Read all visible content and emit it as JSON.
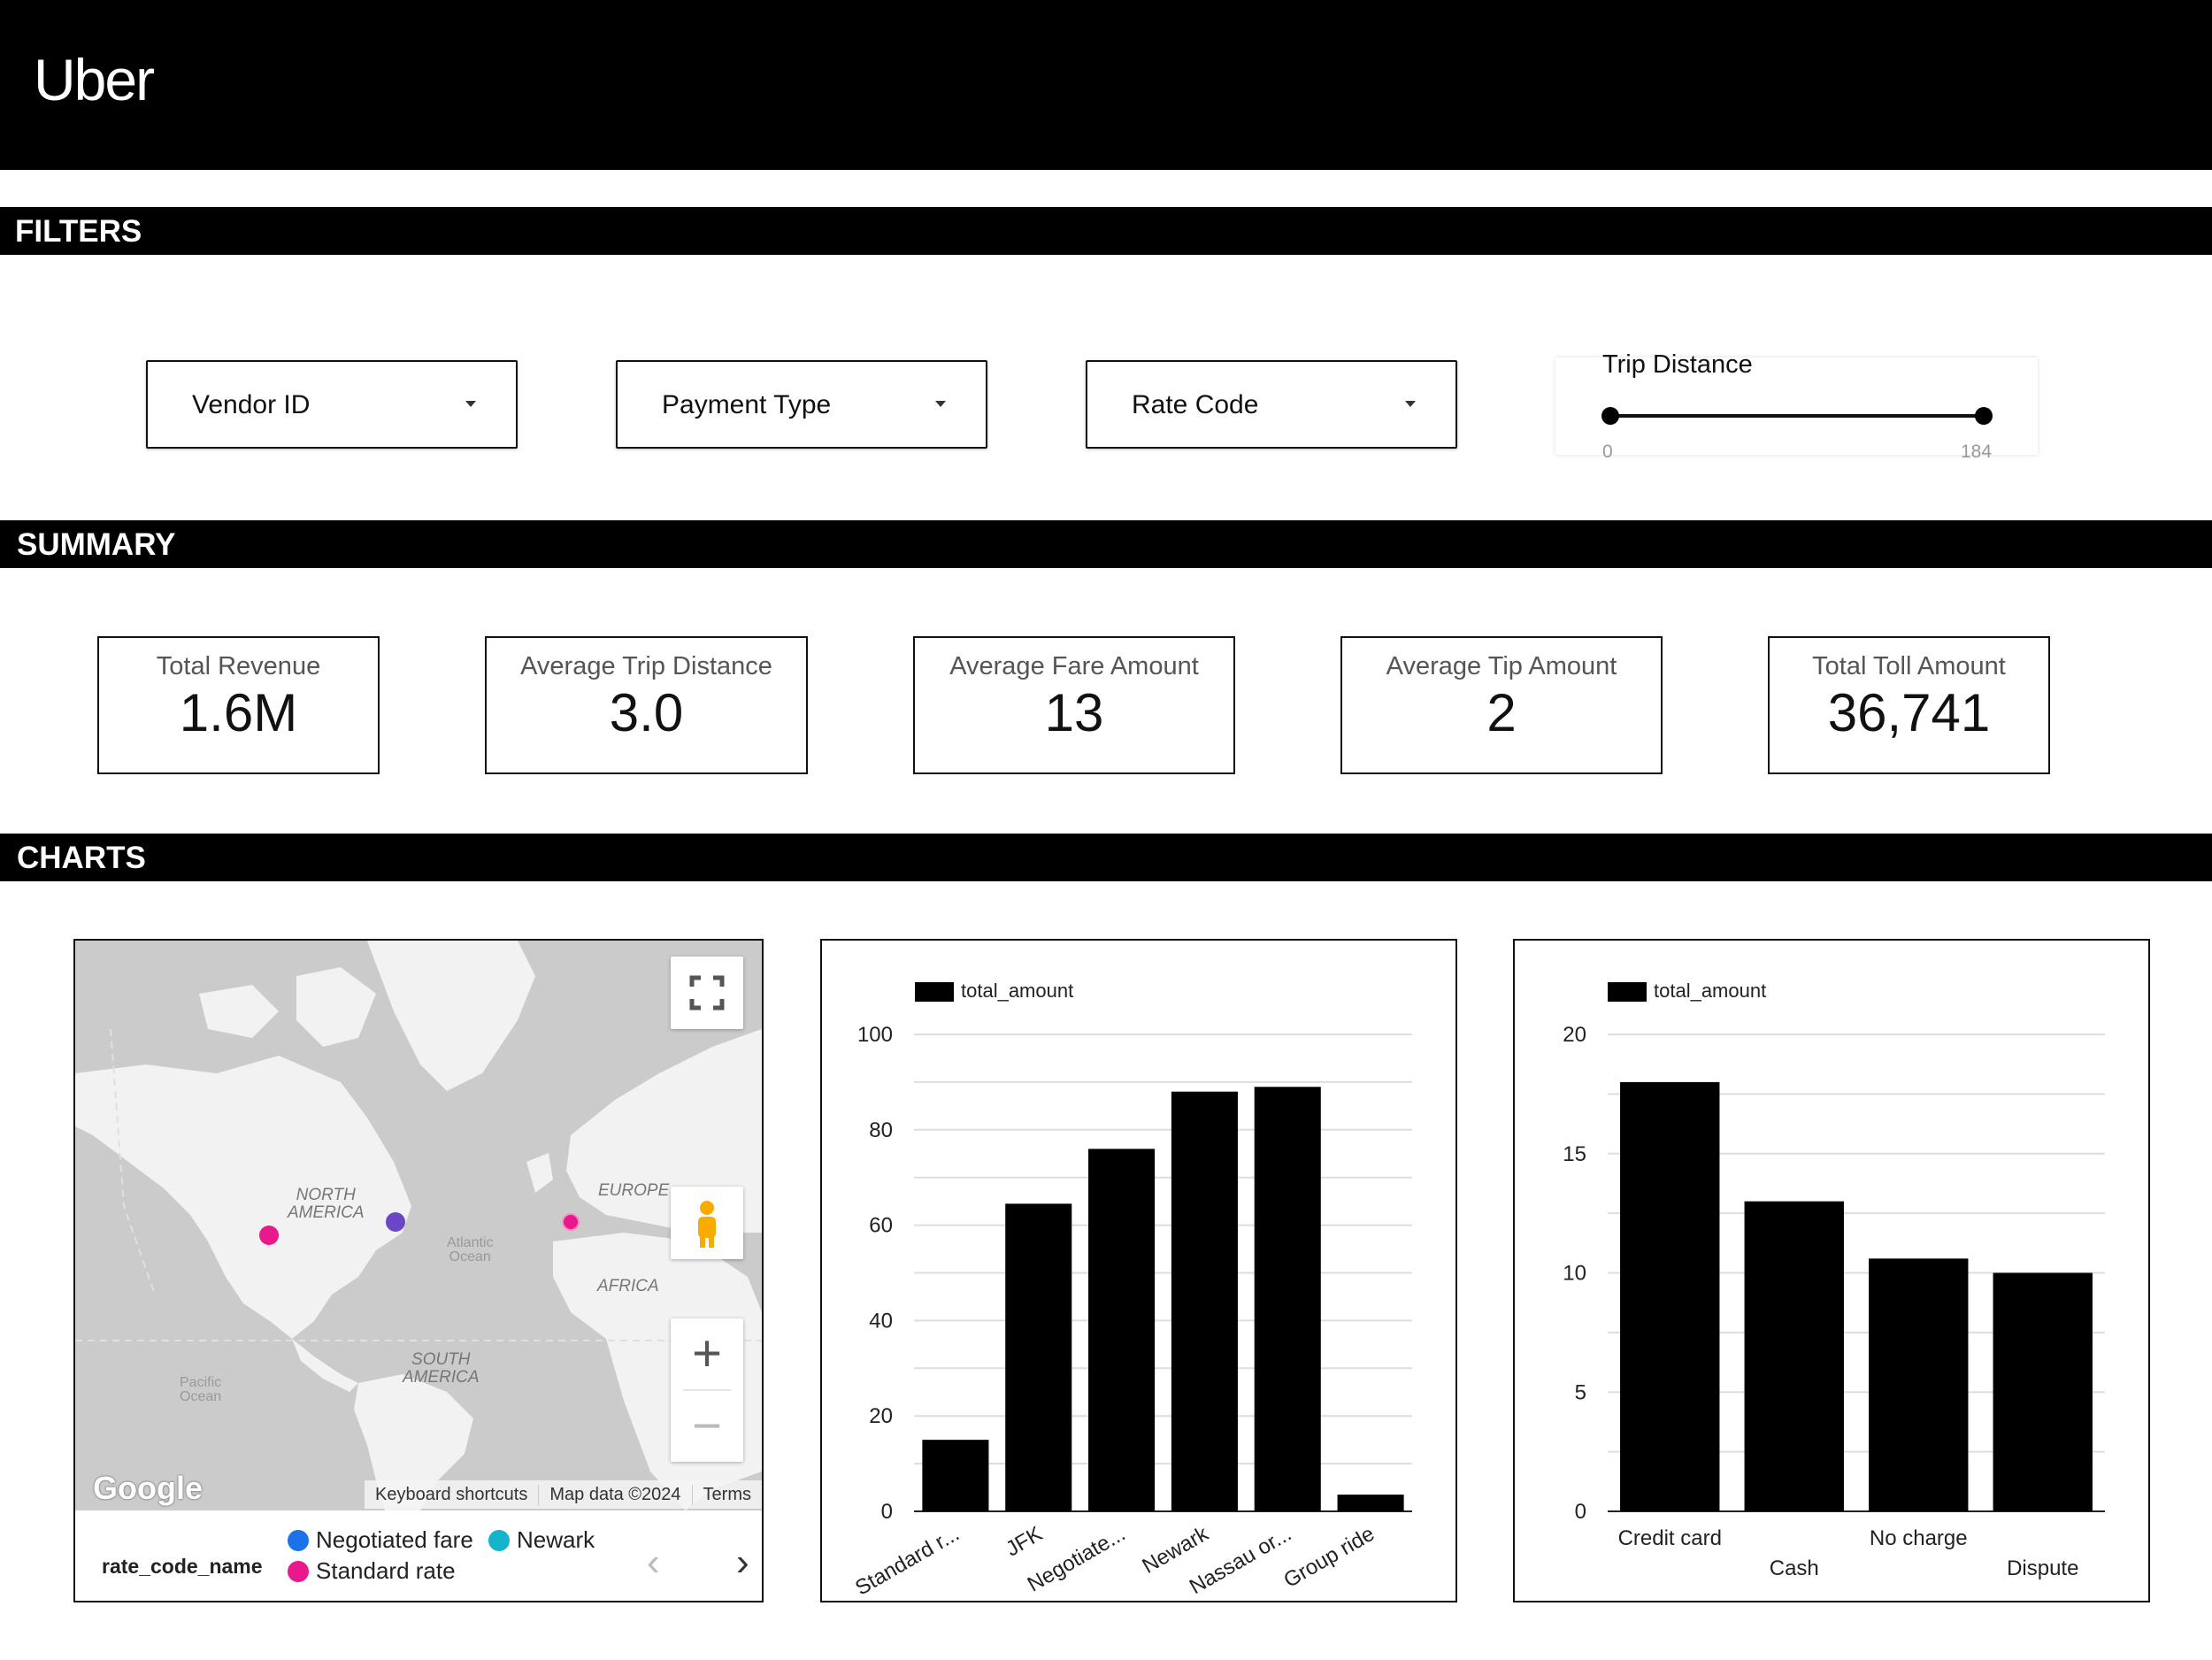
{
  "app": {
    "logo": "Uber"
  },
  "sections": {
    "filters": "FILTERS",
    "summary": "SUMMARY",
    "charts": "CHARTS"
  },
  "filters": {
    "vendor": "Vendor ID",
    "payment": "Payment Type",
    "rate": "Rate Code",
    "trip_distance": {
      "label": "Trip Distance",
      "min": "0",
      "max": "184"
    }
  },
  "summary": {
    "total_revenue": {
      "label": "Total Revenue",
      "value": "1.6M"
    },
    "avg_trip_distance": {
      "label": "Average Trip Distance",
      "value": "3.0"
    },
    "avg_fare": {
      "label": "Average Fare Amount",
      "value": "13"
    },
    "avg_tip": {
      "label": "Average Tip Amount",
      "value": "2"
    },
    "total_toll": {
      "label": "Total Toll Amount",
      "value": "36,741"
    }
  },
  "map": {
    "labels": {
      "north_america_1": "NORTH",
      "north_america_2": "AMERICA",
      "europe": "EUROPE",
      "africa": "AFRICA",
      "south_america_1": "SOUTH",
      "south_america_2": "AMERICA",
      "atlantic_1": "Atlantic",
      "atlantic_2": "Ocean",
      "pacific_1": "Pacific",
      "pacific_2": "Ocean"
    },
    "brand": "Google",
    "footer": {
      "shortcuts": "Keyboard shortcuts",
      "data": "Map data ©2024",
      "terms": "Terms"
    },
    "legend": {
      "title": "rate_code_name",
      "items": [
        {
          "label": "Negotiated fare",
          "color": "#1a73e8"
        },
        {
          "label": "Newark",
          "color": "#12b5cb"
        },
        {
          "label": "Standard rate",
          "color": "#e8198b"
        }
      ]
    },
    "controls": {
      "zoom_in": "+",
      "zoom_out": "−",
      "prev": "‹",
      "next": "›"
    }
  },
  "chart_data": [
    {
      "type": "bar",
      "legend": "total_amount",
      "categories": [
        "Standard r...",
        "JFK",
        "Negotiate...",
        "Newark",
        "Nassau or...",
        "Group ride"
      ],
      "values": [
        15,
        64.5,
        76,
        88,
        89,
        3.5
      ],
      "yticks": [
        "0",
        "20",
        "40",
        "60",
        "80",
        "100"
      ],
      "ylim": [
        0,
        100
      ],
      "grid": true,
      "color": "#000000"
    },
    {
      "type": "bar",
      "legend": "total_amount",
      "categories": [
        "Credit card",
        "Cash",
        "No charge",
        "Dispute"
      ],
      "values": [
        18,
        13,
        10.6,
        10
      ],
      "yticks": [
        "0",
        "5",
        "10",
        "15",
        "20"
      ],
      "ylim": [
        0,
        20
      ],
      "grid": true,
      "color": "#000000"
    }
  ]
}
